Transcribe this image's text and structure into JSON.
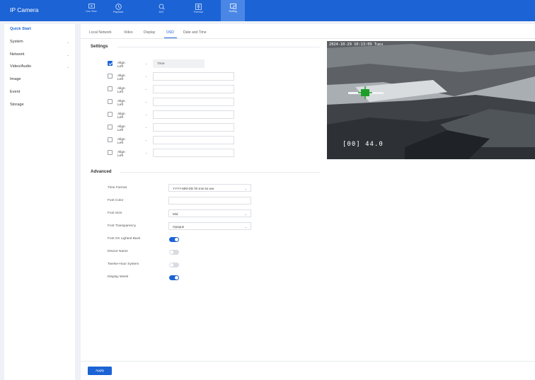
{
  "app": {
    "title": "IP Camera"
  },
  "topnav": [
    {
      "label": "Live View",
      "icon": "live-view-icon"
    },
    {
      "label": "Playback",
      "icon": "playback-icon"
    },
    {
      "label": "AI/C",
      "icon": "ai-icon"
    },
    {
      "label": "Thermal",
      "icon": "thermal-icon"
    },
    {
      "label": "Setting",
      "icon": "setting-icon",
      "active": true
    }
  ],
  "sidebar": {
    "items": [
      {
        "label": "Quick Start",
        "active": true
      },
      {
        "label": "System",
        "expandable": true
      },
      {
        "label": "Network",
        "expandable": true
      },
      {
        "label": "Video/Audio",
        "expandable": true
      },
      {
        "label": "Image"
      },
      {
        "label": "Event"
      },
      {
        "label": "Storage"
      }
    ]
  },
  "tabs": [
    {
      "label": "Local Network"
    },
    {
      "label": "Video"
    },
    {
      "label": "Display"
    },
    {
      "label": "OSD",
      "active": true
    },
    {
      "label": "Date and Time"
    }
  ],
  "settings": {
    "title": "Settings",
    "rows": [
      {
        "checked": true,
        "align": "Align Left",
        "text": "Time"
      },
      {
        "checked": false,
        "align": "Align Left",
        "text": ""
      },
      {
        "checked": false,
        "align": "Align Left",
        "text": ""
      },
      {
        "checked": false,
        "align": "Align Left",
        "text": ""
      },
      {
        "checked": false,
        "align": "Align Left",
        "text": ""
      },
      {
        "checked": false,
        "align": "Align Left",
        "text": ""
      },
      {
        "checked": false,
        "align": "Align Left",
        "text": ""
      },
      {
        "checked": false,
        "align": "Align Left",
        "text": ""
      }
    ]
  },
  "advanced": {
    "title": "Advanced",
    "time_format_label": "Time Format",
    "time_format_value": "YYYY-MM-DD hh:mm:ss ww",
    "font_color_label": "Font Color",
    "font_color_value": "",
    "font_size_label": "Font Size",
    "font_size_value": "Mid",
    "font_transparency_label": "Font Transparency",
    "font_transparency_value": "Opaque",
    "font_on_lighted_back_label": "Font On Lighted Back",
    "font_on_lighted_back_on": true,
    "device_name_label": "Device Name",
    "device_name_on": false,
    "twelve_hour_label": "Twelve-Hour System",
    "twelve_hour_on": false,
    "display_week_label": "Display Week",
    "display_week_on": true
  },
  "preview": {
    "osd_time": "2024-10-29 10:13:09 Tues",
    "osd_temp": "[00] 44.0"
  },
  "apply_label": "Apply",
  "colors": {
    "accent": "#1c63d5",
    "topbar": "#1c63d5"
  }
}
